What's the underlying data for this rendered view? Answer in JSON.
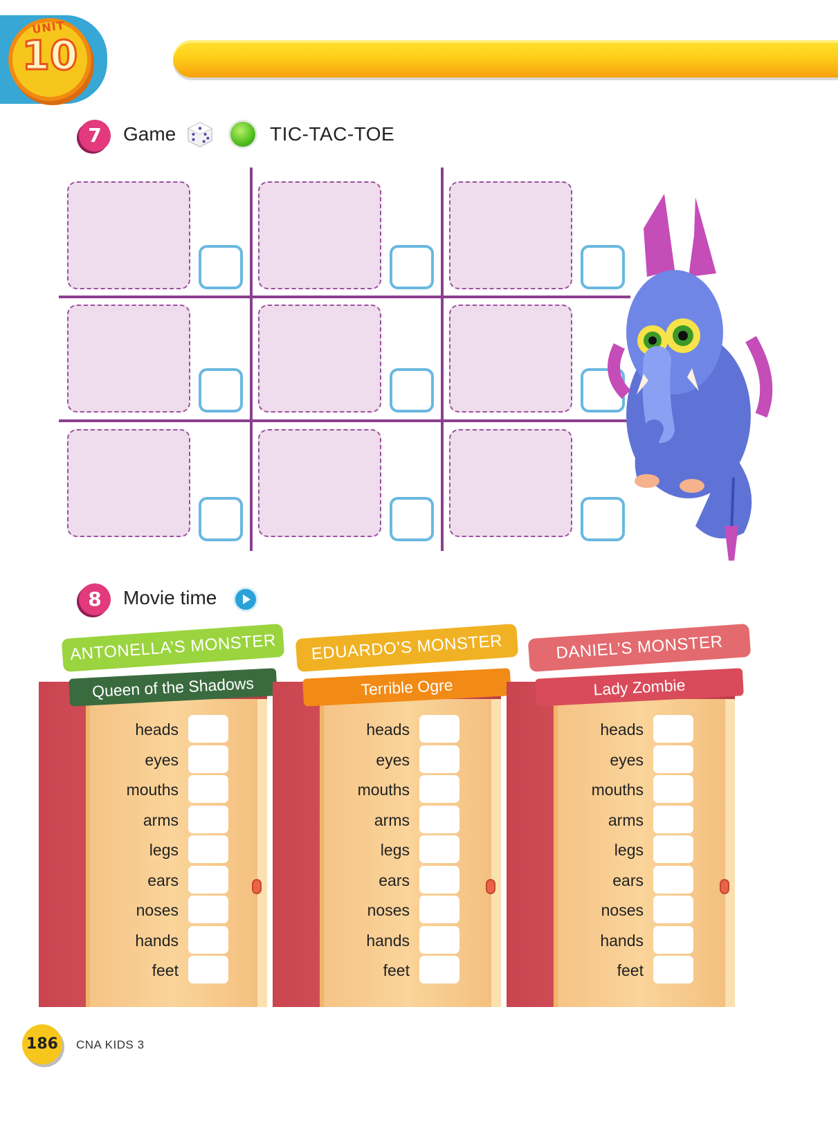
{
  "header": {
    "unit_label": "UNIT",
    "unit_number": "10"
  },
  "activity7": {
    "number": "7",
    "label": "Game",
    "title": "TIC-TAC-TOE"
  },
  "activity8": {
    "number": "8",
    "label": "Movie time"
  },
  "monsters": [
    {
      "owner": "ANTONELLA’S MONSTER",
      "name": "Queen of the Shadows",
      "label_color": "#9ad43e",
      "name_color": "#3a6b3f"
    },
    {
      "owner": "EDUARDO’S MONSTER",
      "name": "Terrible Ogre",
      "label_color": "#f0b224",
      "name_color": "#f28a16"
    },
    {
      "owner": "DANIEL’S  MONSTER",
      "name": "Lady Zombie",
      "label_color": "#e36a6e",
      "name_color": "#d94b5a"
    }
  ],
  "body_parts": [
    "heads",
    "eyes",
    "mouths",
    "arms",
    "legs",
    "ears",
    "noses",
    "hands",
    "feet"
  ],
  "footer": {
    "page_number": "186",
    "book_title": "CNA KIDS 3"
  }
}
